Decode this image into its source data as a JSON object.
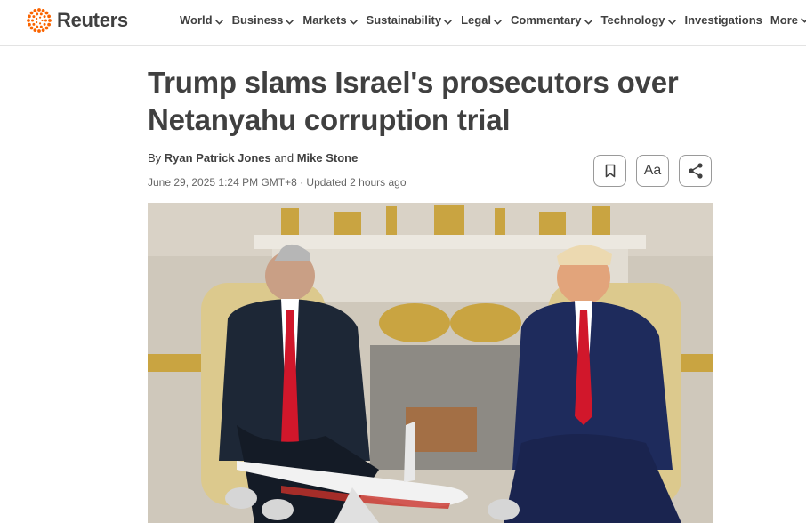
{
  "site": {
    "logo_text": "Reuters",
    "logo_icon": "reuters-dots-logo",
    "accent_color": "#fa6400"
  },
  "nav": {
    "items": [
      {
        "label": "World",
        "icon": "chevron-down-icon"
      },
      {
        "label": "Business",
        "icon": "chevron-down-icon"
      },
      {
        "label": "Markets",
        "icon": "chevron-down-icon"
      },
      {
        "label": "Sustainability",
        "icon": "chevron-down-icon"
      },
      {
        "label": "Legal",
        "icon": "chevron-down-icon"
      },
      {
        "label": "Commentary",
        "icon": "chevron-down-icon"
      },
      {
        "label": "Technology",
        "icon": "chevron-down-icon"
      },
      {
        "label": "Investigations"
      },
      {
        "label": "More",
        "icon": "chevron-down-icon"
      }
    ]
  },
  "article": {
    "headline": "Trump slams Israel's prosecutors over Netanyahu corruption trial",
    "byline": {
      "prefix": "By",
      "author1": "Ryan Patrick Jones",
      "conjunction": "and",
      "author2": "Mike Stone"
    },
    "dateline": "June 29, 2025 1:24 PM GMT+8 · Updated 2 hours ago",
    "actions": {
      "bookmark_icon": "bookmark-icon",
      "text_size_label": "Aa",
      "share_icon": "share-icon"
    }
  }
}
